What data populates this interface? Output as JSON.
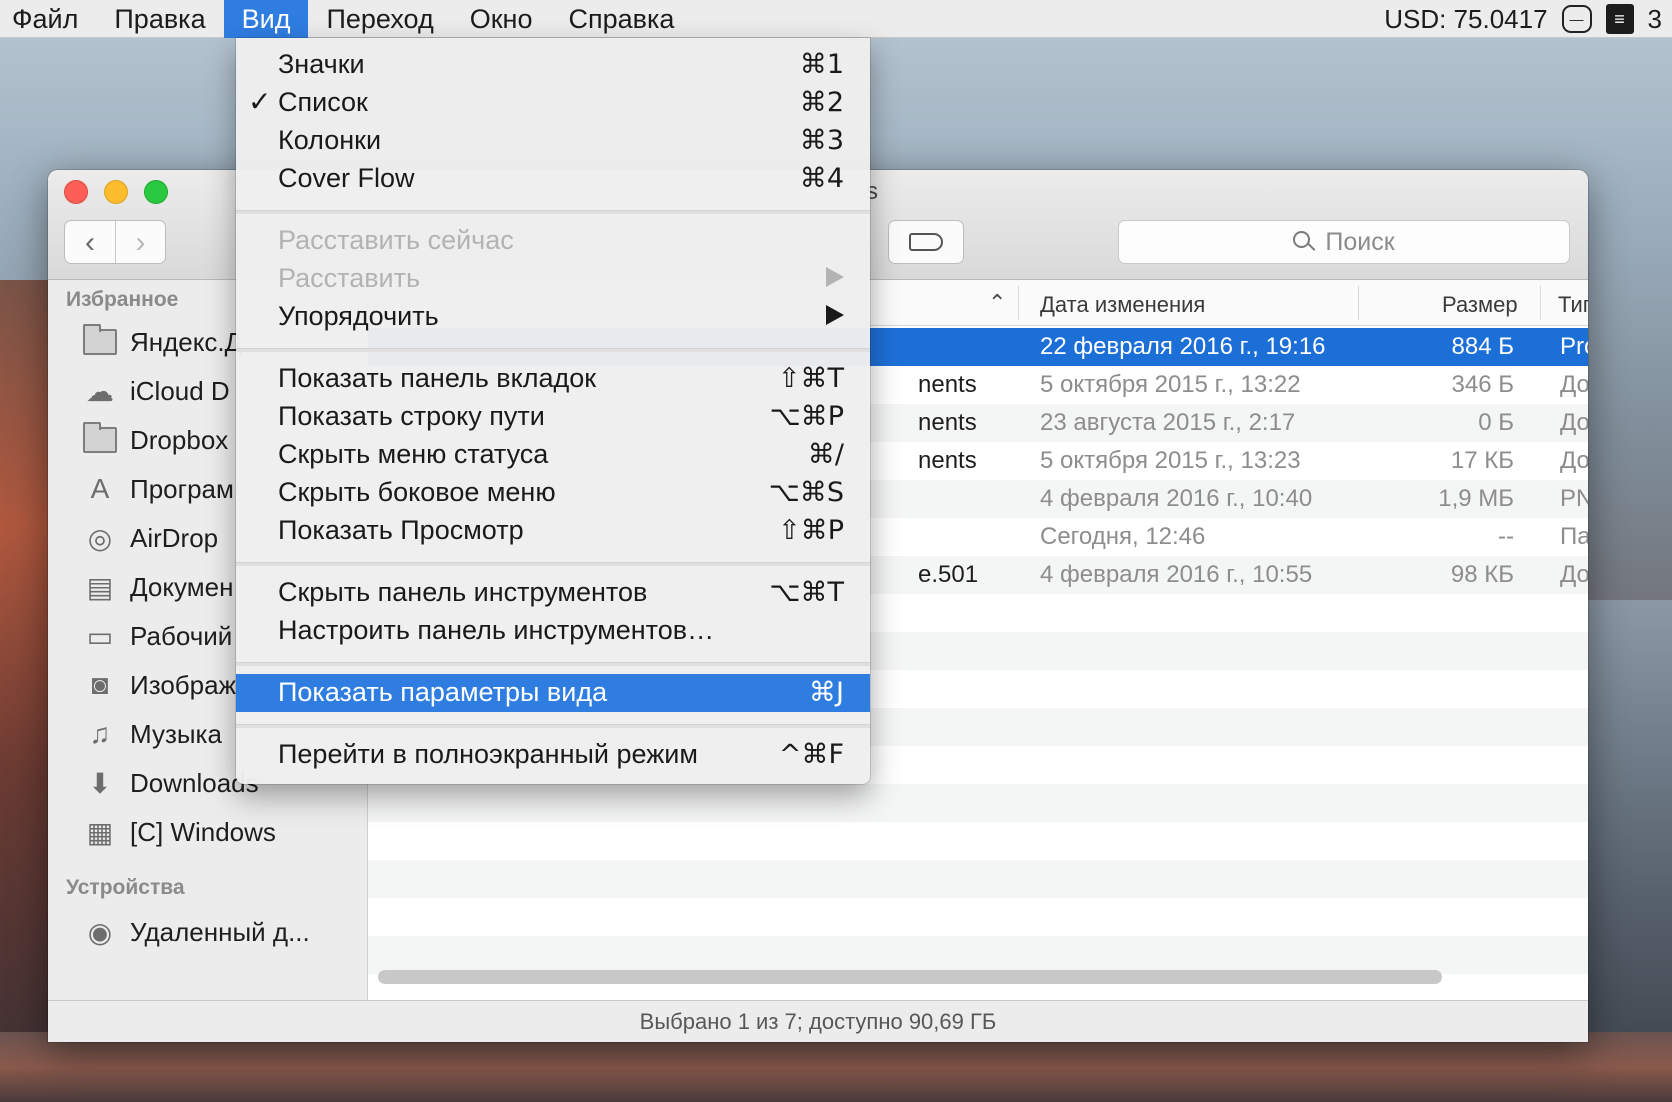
{
  "menubar": {
    "items": [
      "Файл",
      "Правка",
      "Вид",
      "Переход",
      "Окно",
      "Справка"
    ],
    "active_index": 2,
    "currency": "USD: 75.0417",
    "badge_count": "3"
  },
  "dropdown": {
    "items": [
      {
        "label": "Значки",
        "shortcut": "⌘1",
        "checked": false
      },
      {
        "label": "Список",
        "shortcut": "⌘2",
        "checked": true,
        "check": "✓"
      },
      {
        "label": "Колонки",
        "shortcut": "⌘3"
      },
      {
        "label": "Cover Flow",
        "shortcut": "⌘4"
      },
      {
        "label": "Расставить сейчас",
        "disabled": true
      },
      {
        "label": "Расставить",
        "disabled": true,
        "submenu": true
      },
      {
        "label": "Упорядочить",
        "submenu": true
      },
      {
        "label": "Показать панель вкладок",
        "shortcut": "⇧⌘T"
      },
      {
        "label": "Показать строку пути",
        "shortcut": "⌥⌘P"
      },
      {
        "label": "Скрыть меню статуса",
        "shortcut": "⌘/"
      },
      {
        "label": "Скрыть боковое меню",
        "shortcut": "⌥⌘S"
      },
      {
        "label": "Показать Просмотр",
        "shortcut": "⇧⌘P"
      },
      {
        "label": "Скрыть панель инструментов",
        "shortcut": "⌥⌘T"
      },
      {
        "label": "Настроить панель инструментов…"
      },
      {
        "label": "Показать параметры вида",
        "shortcut": "⌘J",
        "highlighted": true
      },
      {
        "label": "Перейти в полноэкранный режим",
        "shortcut": "^⌘F"
      }
    ]
  },
  "window": {
    "title_fragment": "s",
    "search_placeholder": "Поиск",
    "back_glyph": "‹",
    "forward_glyph": "›"
  },
  "sidebar": {
    "favorites_header": "Избранное",
    "devices_header": "Устройства",
    "favorites": [
      {
        "label": "Яндекс.Д",
        "icon": "folder-icon"
      },
      {
        "label": "iCloud D",
        "icon": "cloud-icon"
      },
      {
        "label": "Dropbox",
        "icon": "folder-icon"
      },
      {
        "label": "Програм",
        "icon": "applications-icon"
      },
      {
        "label": "AirDrop",
        "icon": "airdrop-icon"
      },
      {
        "label": "Докумен",
        "icon": "documents-icon"
      },
      {
        "label": "Рабочий",
        "icon": "desktop-icon"
      },
      {
        "label": "Изображ",
        "icon": "camera-icon"
      },
      {
        "label": "Музыка",
        "icon": "music-icon"
      },
      {
        "label": "Downloads",
        "icon": "downloads-icon"
      },
      {
        "label": "[C] Windows",
        "icon": "disk-icon"
      }
    ],
    "devices": [
      {
        "label": "Удаленный д...",
        "icon": "remote-disc-icon"
      }
    ]
  },
  "list": {
    "columns": {
      "date": "Дата изменения",
      "size": "Размер",
      "type": "Тип"
    },
    "rows": [
      {
        "name": "",
        "date": "22 февраля 2016 г., 19:16",
        "size": "884 Б",
        "type": "Prop",
        "selected": true
      },
      {
        "name": "nents",
        "date": "5 октября 2015 г., 13:22",
        "size": "346 Б",
        "type": "Док"
      },
      {
        "name": "nents",
        "date": "23 августа 2015 г., 2:17",
        "size": "0 Б",
        "type": "Док"
      },
      {
        "name": "nents",
        "date": "5 октября 2015 г., 13:23",
        "size": "17 КБ",
        "type": "Док"
      },
      {
        "name": "",
        "date": "4 февраля 2016 г., 10:40",
        "size": "1,9 МБ",
        "type": "PNG"
      },
      {
        "name": "",
        "date": "Сегодня, 12:46",
        "size": "--",
        "type": "Пап"
      },
      {
        "name": "e.501",
        "date": "4 февраля 2016 г., 10:55",
        "size": "98 КБ",
        "type": "Док"
      }
    ]
  },
  "status": "Выбрано 1 из 7; доступно 90,69 ГБ",
  "colors": {
    "accent": "#2f7de1",
    "selection": "#1d6fd8"
  }
}
